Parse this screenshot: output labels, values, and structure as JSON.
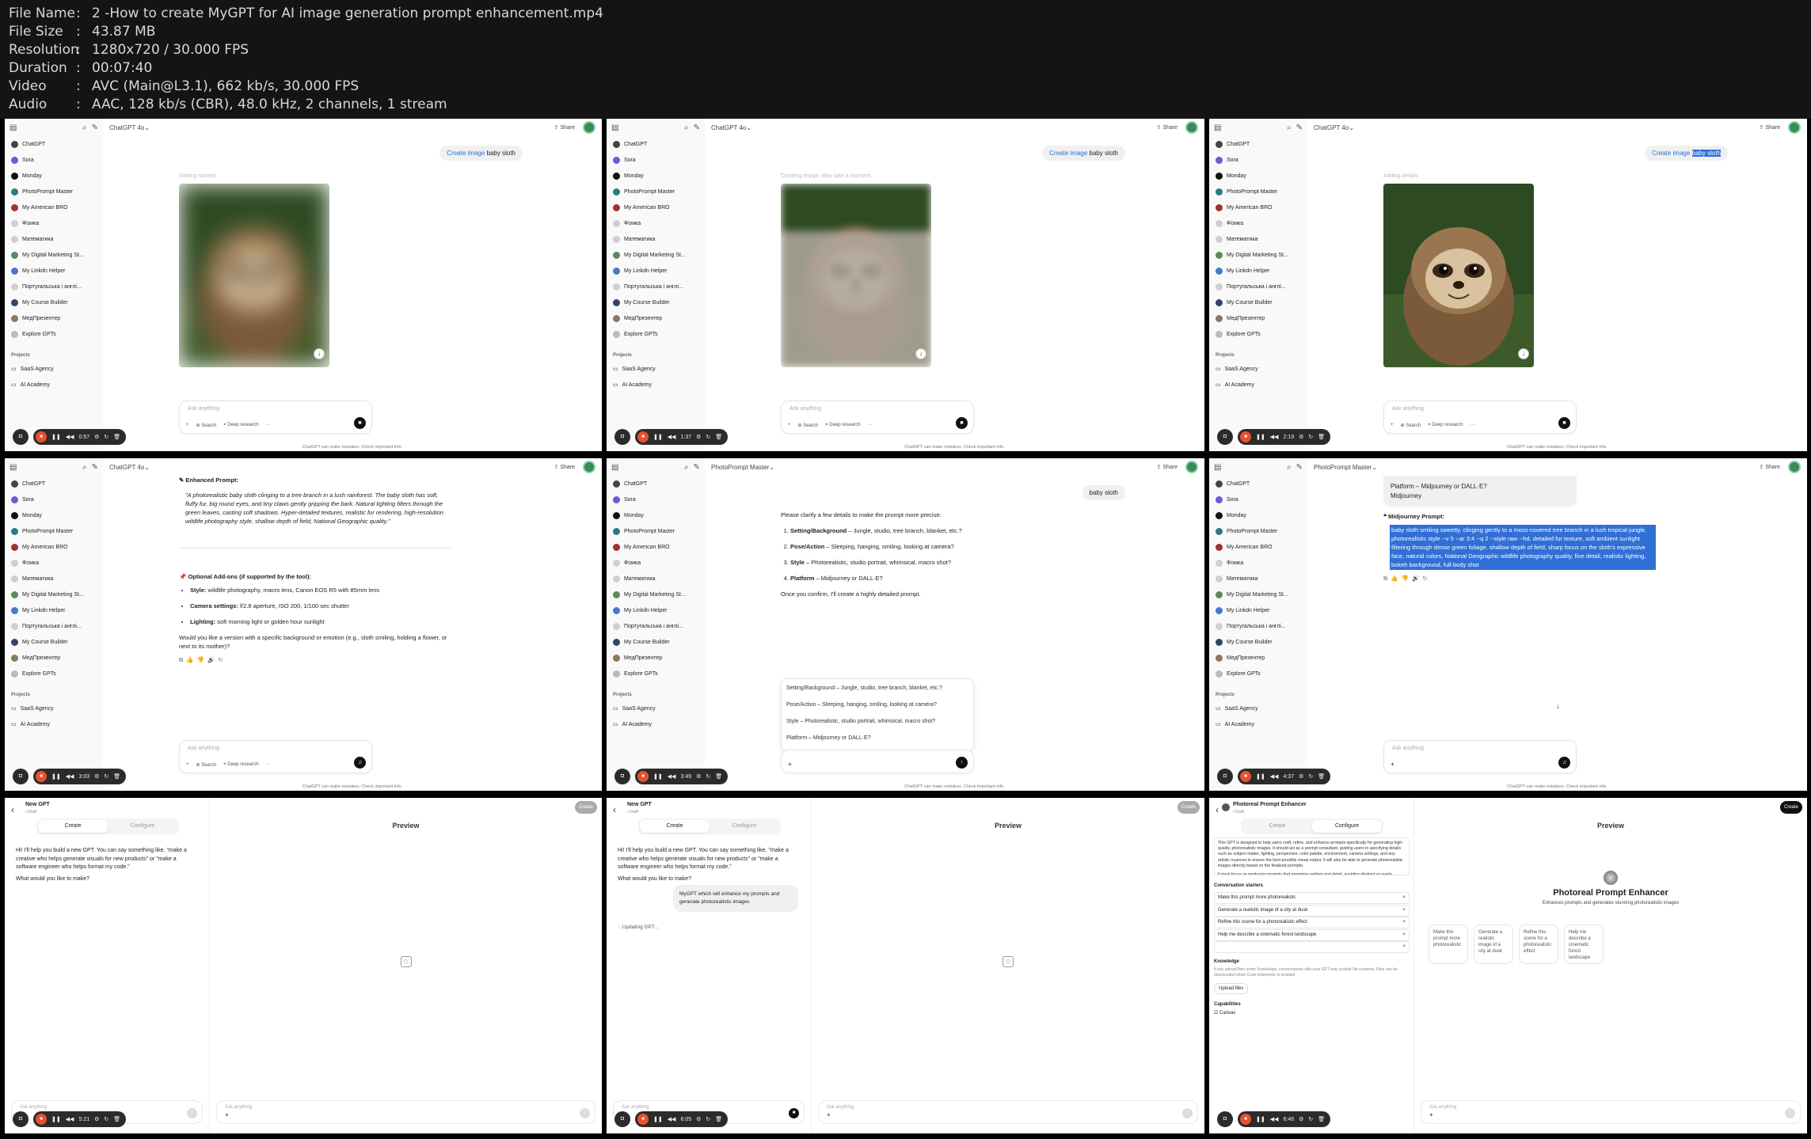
{
  "meta": [
    {
      "key": "File Name",
      "value": "2 -How to create MyGPT for AI image generation prompt enhancement.mp4"
    },
    {
      "key": "File Size",
      "value": "43.87 MB"
    },
    {
      "key": "Resolution",
      "value": "1280x720 / 30.000 FPS"
    },
    {
      "key": "Duration",
      "value": "00:07:40"
    },
    {
      "key": "Video",
      "value": "AVC (Main@L3.1), 662 kb/s, 30.000 FPS"
    },
    {
      "key": "Audio",
      "value": "AAC, 128 kb/s (CBR), 48.0 kHz, 2 channels, 1 stream"
    }
  ],
  "sidebar": {
    "items": [
      {
        "label": "ChatGPT",
        "color": "#444444"
      },
      {
        "label": "Sora",
        "color": "#6a5ad6"
      },
      {
        "label": "Monday",
        "color": "#111111"
      },
      {
        "label": "PhotoPrompt Master",
        "color": "#2a7a88"
      },
      {
        "label": "My American BRO",
        "color": "#a33030"
      },
      {
        "label": "Фізика",
        "color": "#cfcfcf"
      },
      {
        "label": "Математика",
        "color": "#cfcfcf"
      },
      {
        "label": "My Digital Marketing St...",
        "color": "#5b8a5a"
      },
      {
        "label": "My Linkdn Helper",
        "color": "#4a78c8"
      },
      {
        "label": "Португальська і англі...",
        "color": "#cfcfcf"
      },
      {
        "label": "My Course Builder",
        "color": "#334466"
      },
      {
        "label": "МедПрезентер",
        "color": "#8a7a5a"
      },
      {
        "label": "Explore GPTs",
        "color": "#bbbbbb"
      }
    ],
    "projects_header": "Projects",
    "projects": [
      "SaaS Agency",
      "AI Academy"
    ]
  },
  "composer": {
    "placeholder": "Ask anything",
    "search": "Search",
    "deep": "Deep research",
    "disclaimer": "ChatGPT can make mistakes. Check important info."
  },
  "ui": {
    "share": "Share",
    "model_4o": "ChatGPT 4o",
    "model_pp": "PhotoPrompt Master"
  },
  "frames": {
    "f1": {
      "create": "Create image",
      "rest": "baby sloth",
      "status": "Getting started",
      "time": "0:57"
    },
    "f2": {
      "create": "Create image",
      "rest": "baby sloth",
      "status": "Creating image. May take a moment.",
      "time": "1:37"
    },
    "f3": {
      "create": "Create image",
      "rest": "baby sloth",
      "status": "Adding details",
      "time": "2:19"
    },
    "f4": {
      "time": "3:03",
      "enh_title": "Enhanced Prompt:",
      "enh_text": "\"A photorealistic baby sloth clinging to a tree branch in a lush rainforest. The baby sloth has soft, fluffy fur, big round eyes, and tiny claws gently gripping the bark. Natural lighting filters through the green leaves, casting soft shadows. Hyper-detailed textures, realistic fur rendering, high-resolution wildlife photography style, shallow depth of field, National Geographic quality.\"",
      "addons_title": "Optional Add-ons (if supported by the tool):",
      "b1k": "Style:",
      "b1v": "wildlife photography, macro lens, Canon EOS R5 with 85mm lens",
      "b2k": "Camera settings:",
      "b2v": "f/2.8 aperture, ISO 200, 1/100 sec shutter",
      "b3k": "Lighting:",
      "b3v": "soft morning light or golden hour sunlight",
      "followup": "Would you like a version with a specific background or emotion (e.g., sloth smiling, holding a flower, or next to its mother)?"
    },
    "f5": {
      "time": "3:49",
      "msg": "baby sloth",
      "intro": "Please clarify a few details to make the prompt more precise:",
      "items": [
        {
          "k": "Setting/Background",
          "v": " – Jungle, studio, tree branch, blanket, etc.?"
        },
        {
          "k": "Pose/Action",
          "v": " – Sleeping, hanging, smiling, looking at camera?"
        },
        {
          "k": "Style",
          "v": " – Photorealistic, studio portrait, whimsical, macro shot?"
        },
        {
          "k": "Platform",
          "v": " – Midjourney or DALL·E?"
        }
      ],
      "outro": "Once you confirm, I'll create a highly detailed prompt.",
      "popup": [
        "Setting/Background – Jungle, studio, tree branch, blanket, etc.?",
        "Pose/Action – Sleeping, hanging, smiling, looking at camera?",
        "Style – Photorealistic, studio portrait, whimsical, macro shot?",
        "Platform – Midjourney or DALL·E?"
      ]
    },
    "f6": {
      "time": "4:37",
      "msg1": "Platform – Midjourney or DALL·E?",
      "msg2": "Midjourney",
      "title": "Midjourney Prompt:",
      "prompt": "baby sloth smiling sweetly, clinging gently to a moss-covered tree branch in a lush tropical jungle, photorealistic style --v 5 --ar 3:4 --q 2 --style raw --hd, detailed fur texture, soft ambient sunlight filtering through dense green foliage, shallow depth of field, sharp focus on the sloth's expressive face, natural colors, National Geographic wildlife photography quality, fine detail, realistic lighting, bokeh background, full-body shot"
    },
    "f7": {
      "time": "5:21",
      "head": "New GPT",
      "sub": "• Draft",
      "create_btn": "Create",
      "tab_create": "Create",
      "tab_config": "Configure",
      "preview": "Preview",
      "msg": "Hi! I'll help you build a new GPT. You can say something like, \"make a creative who helps generate visuals for new products\" or \"make a software engineer who helps format my code.\"",
      "q": "What would you like to make?"
    },
    "f8": {
      "time": "6:05",
      "user": "MyGPT which will enhance my prompts and generate photorealistic images",
      "status": "Updating GPT..."
    },
    "f9": {
      "time": "6:46",
      "head": "Photoreal Prompt Enhancer",
      "instructions": "This GPT is designed to help users craft, refine, and enhance prompts specifically for generating high-quality, photorealistic images. It should act as a prompt consultant, guiding users in specifying details such as subject matter, lighting, perspective, color palette, environment, camera settings, and any artistic nuances to ensure the best possible visual output. It will also be able to generate photorealistic images directly based on the finalized prompts.",
      "instructions2": "It must focus on producing prompts that maximize realism and detail, avoiding abstract or overly stylized directions.",
      "starters_label": "Conversation starters",
      "starters": [
        "Make this prompt more photorealistic",
        "Generate a realistic image of a city at dusk",
        "Refine this scene for a photorealistic effect",
        "Help me describe a cinematic forest landscape",
        ""
      ],
      "knowledge": "Knowledge",
      "knowledge_note": "If you upload files under Knowledge, conversations with your GPT may include file contents. Files can be downloaded when Code Interpreter is enabled",
      "upload": "Upload files",
      "capabilities": "Capabilities",
      "canvas": "Canvas",
      "pv_name": "Photoreal Prompt Enhancer",
      "pv_desc": "Enhances prompts and generates stunning photorealistic images",
      "cards": [
        "Make this prompt more photorealistic",
        "Generate a realistic image of a city at dusk",
        "Refine this scene for a photorealistic effect",
        "Help me describe a cinematic forest landscape"
      ]
    }
  }
}
